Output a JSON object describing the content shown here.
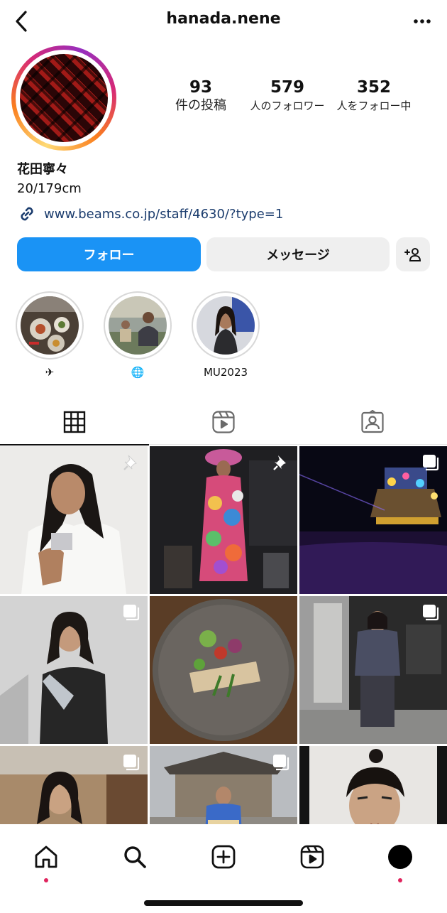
{
  "header": {
    "username": "hanada.nene"
  },
  "profile": {
    "stats": [
      {
        "value": "93",
        "label": "件の投稿"
      },
      {
        "value": "579",
        "label": "人のフォロワー"
      },
      {
        "value": "352",
        "label": "人をフォロー中"
      }
    ],
    "name": "花田寧々",
    "bio": "20/179cm",
    "link": "www.beams.co.jp/staff/4630/?type=1"
  },
  "actions": {
    "follow_label": "フォロー",
    "message_label": "メッセージ",
    "suggest_icon": "add-person-icon"
  },
  "highlights": [
    {
      "label": "✈",
      "icon": "airplane-glyph"
    },
    {
      "label": "🌐",
      "icon": "globe-glyph"
    },
    {
      "label": "MU2023",
      "icon": ""
    }
  ],
  "tabs": [
    {
      "icon": "grid-icon",
      "active": true
    },
    {
      "icon": "reels-icon",
      "active": false
    },
    {
      "icon": "tagged-icon",
      "active": false
    }
  ],
  "posts": [
    {
      "badge": "pin-icon"
    },
    {
      "badge": "pin-icon"
    },
    {
      "badge": "multiple-icon"
    },
    {
      "badge": "multiple-icon"
    },
    {
      "badge": ""
    },
    {
      "badge": "multiple-icon"
    },
    {
      "badge": "multiple-icon"
    },
    {
      "badge": "multiple-icon"
    },
    {
      "badge": ""
    }
  ],
  "bottom_nav": [
    "home-icon",
    "search-icon",
    "create-icon",
    "reels-icon",
    "profile-icon"
  ],
  "colors": {
    "follow_button": "#1a93f5",
    "link_text": "#1c3d6e",
    "notification_dot": "#e0245e"
  }
}
